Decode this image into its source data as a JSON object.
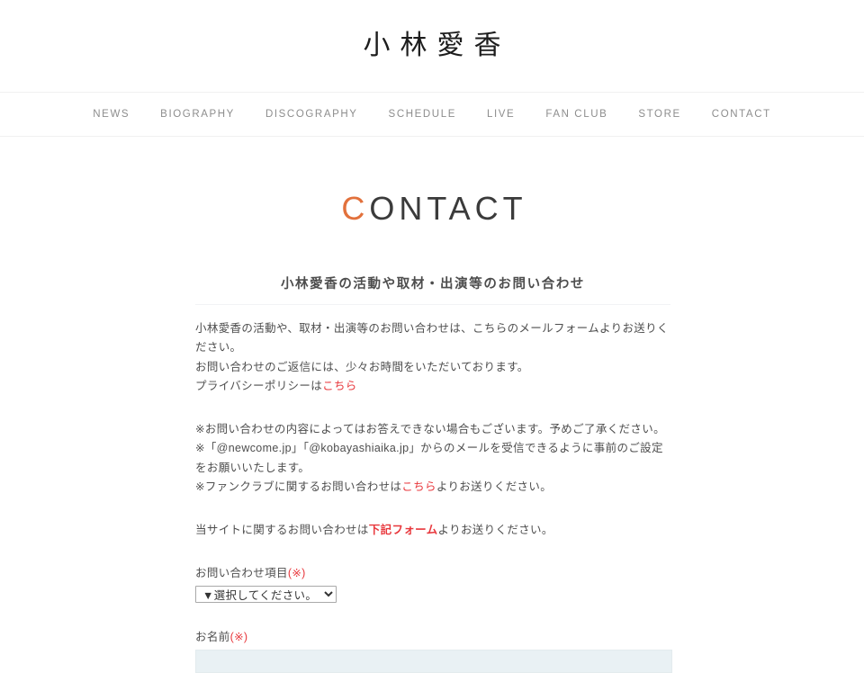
{
  "header": {
    "site_title": "小林愛香"
  },
  "nav": {
    "items": [
      {
        "label": "NEWS"
      },
      {
        "label": "BIOGRAPHY"
      },
      {
        "label": "DISCOGRAPHY"
      },
      {
        "label": "SCHEDULE"
      },
      {
        "label": "LIVE"
      },
      {
        "label": "FAN CLUB"
      },
      {
        "label": "STORE"
      },
      {
        "label": "CONTACT"
      }
    ]
  },
  "page": {
    "title_accent": "C",
    "title_rest": "ONTACT",
    "section_heading": "小林愛香の活動や取材・出演等のお問い合わせ"
  },
  "intro": {
    "line1": "小林愛香の活動や、取材・出演等のお問い合わせは、こちらのメールフォームよりお送りください。",
    "line2": "お問い合わせのご返信には、少々お時間をいただいております。",
    "line3_pre": "プライバシーポリシーは",
    "line3_link": "こちら"
  },
  "notes": {
    "line1": "※お問い合わせの内容によってはお答えできない場合もございます。予めご了承ください。",
    "line2": "※「@newcome.jp」「@kobayashiaika.jp」からのメールを受信できるように事前のご設定をお願いいたします。",
    "line3_pre": "※ファンクラブに関するお問い合わせは",
    "line3_link": "こちら",
    "line3_post": "よりお送りください。"
  },
  "site_note": {
    "pre": "当サイトに関するお問い合わせは",
    "link": "下記フォーム",
    "post": "よりお送りください。"
  },
  "form": {
    "subject": {
      "label_text": "お問い合わせ項目",
      "label_req": "(※)",
      "selected": "▼選択してください。",
      "options": [
        "▼選択してください。"
      ]
    },
    "name": {
      "label_text": "お名前",
      "label_req": "(※)",
      "value": "",
      "placeholder": ""
    }
  },
  "colors": {
    "accent_orange": "#e2713c",
    "link_red": "#e8373c",
    "nav_gray": "#8d8d8d",
    "input_fill": "#e9f1f4"
  }
}
